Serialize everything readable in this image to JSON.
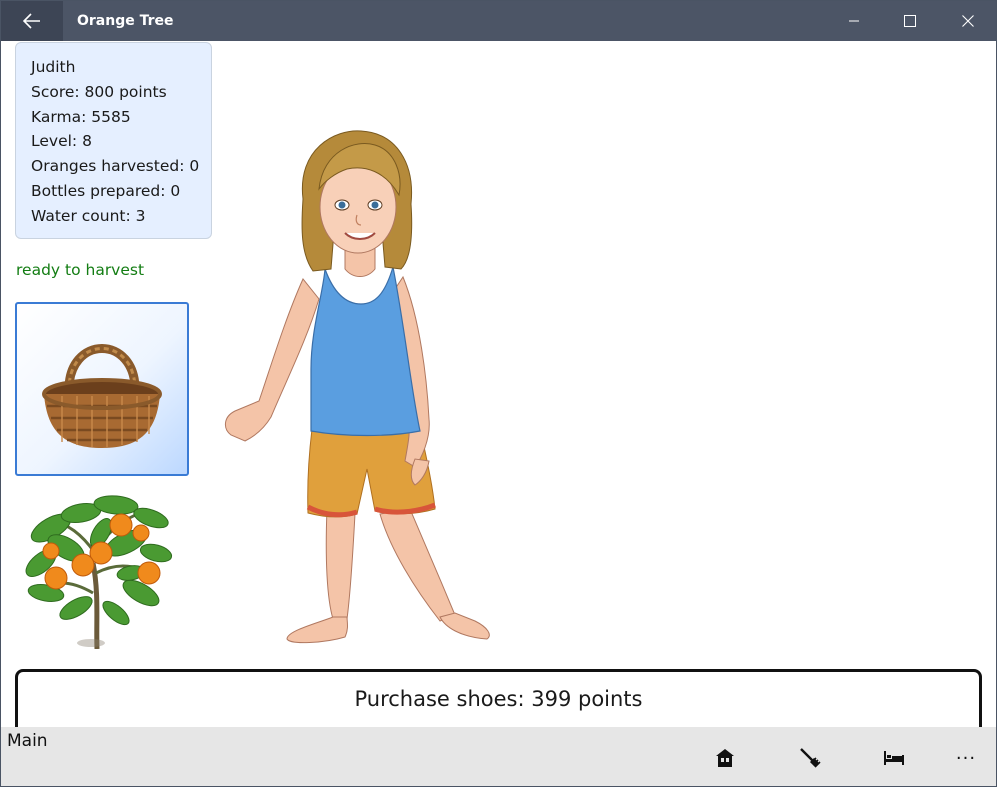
{
  "window": {
    "title": "Orange Tree",
    "controls": [
      "minimize-icon",
      "maximize-icon",
      "close-icon"
    ]
  },
  "player": {
    "name": "Judith",
    "score": "Score: 800 points",
    "karma": "Karma: 5585",
    "level": "Level: 8",
    "oranges": "Oranges harvested: 0",
    "bottles": "Bottles prepared: 0",
    "water": "Water count: 3"
  },
  "status": {
    "text": "ready to harvest",
    "color": "#137d13"
  },
  "actions": {
    "basket_icon": "basket-icon",
    "purchase_label": "Purchase shoes: 399 points"
  },
  "commandbar": {
    "label": "Main",
    "buttons": [
      "home-icon",
      "rake-icon",
      "bed-icon",
      "more-icon"
    ],
    "more_label": "···"
  },
  "colors": {
    "titlebar": "#4c5566",
    "stats_bg": "#e5efff",
    "basket_border": "#3a7bd5",
    "cmdbar": "#e6e6e6"
  }
}
